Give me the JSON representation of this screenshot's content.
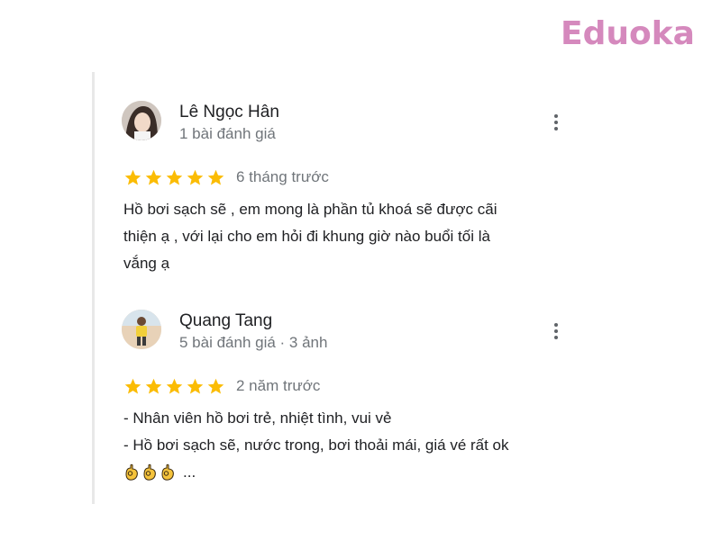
{
  "brand": {
    "logo_text": "Eduoka",
    "color": "#d589bd"
  },
  "colors": {
    "star": "#fbbc04",
    "meta_text": "#70757a",
    "body_text": "#202124"
  },
  "reviews": [
    {
      "name": "Lê Ngọc Hân",
      "meta": "1 bài đánh giá",
      "rating": 5,
      "time": "6 tháng trước",
      "text_lines": [
        "Hồ bơi sạch sẽ , em mong là phần tủ khoá sẽ được cãi",
        "thiện ạ , với lại cho em hỏi đi khung giờ nào buổi tối là",
        "vắng ạ"
      ],
      "more_icon": "more-vert-icon"
    },
    {
      "name": "Quang Tang",
      "meta": "5 bài đánh giá · 3 ảnh",
      "rating": 5,
      "time": "2 năm trước",
      "text_lines": [
        "- Nhân viên hồ bơi trẻ, nhiệt tình, vui vẻ",
        "- Hồ bơi sạch sẽ, nước trong, bơi thoải mái, giá vé rất ok"
      ],
      "trailing_emojis": [
        "ok-hand-icon",
        "ok-hand-icon",
        "ok-hand-icon"
      ],
      "trailing_text": "...",
      "more_icon": "more-vert-icon"
    }
  ]
}
